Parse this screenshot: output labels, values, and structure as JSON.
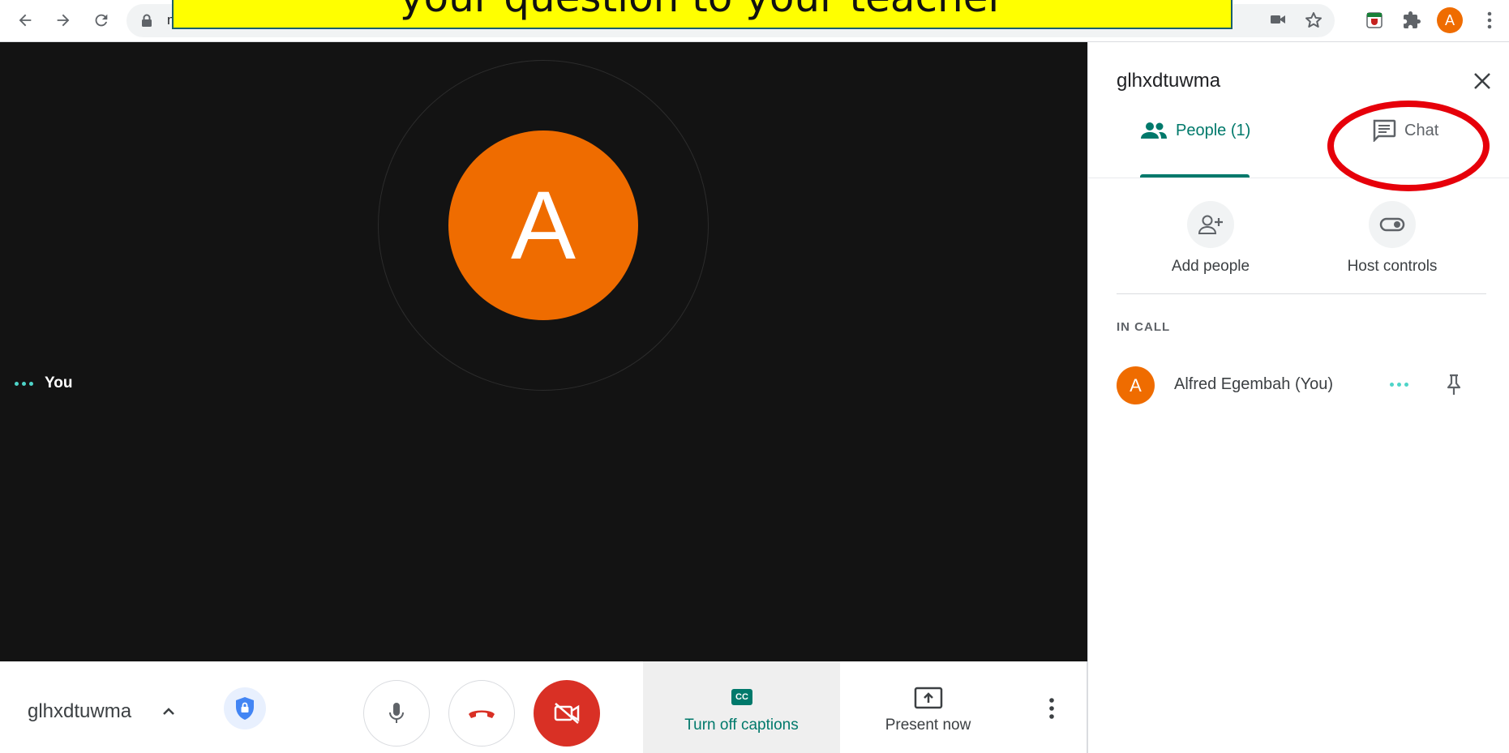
{
  "browser": {
    "url_fragment": "m",
    "profile_initial": "A"
  },
  "banner": {
    "text": "your question to your teacher"
  },
  "video": {
    "avatar_initial": "A",
    "self_label": "You"
  },
  "bottom_bar": {
    "meeting_code": "glhxdtuwma",
    "captions_label": "Turn off captions",
    "captions_icon_text": "CC",
    "present_label": "Present now"
  },
  "panel": {
    "title": "glhxdtuwma",
    "tabs": [
      {
        "label": "People (1)",
        "icon": "people-icon",
        "active": true
      },
      {
        "label": "Chat",
        "icon": "chat-icon",
        "active": false
      }
    ],
    "actions": [
      {
        "label": "Add people",
        "icon": "add-person-icon"
      },
      {
        "label": "Host controls",
        "icon": "toggle-icon"
      }
    ],
    "section_label": "IN CALL",
    "participants": [
      {
        "initial": "A",
        "name": "Alfred Egembah (You)"
      }
    ]
  },
  "colors": {
    "accent": "#00796b",
    "avatar": "#ef6c00",
    "danger": "#d93025",
    "annotation": "#e6000a"
  }
}
